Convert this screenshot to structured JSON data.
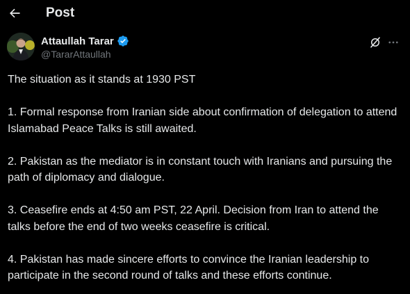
{
  "header": {
    "title": "Post",
    "back_icon": "arrow-left-icon"
  },
  "author": {
    "display_name": "Attaullah Tarar",
    "handle": "@TararAttaullah",
    "verified_color": "#1d9bf0"
  },
  "actions": {
    "grok_icon": "grok-icon",
    "more_icon": "more-horizontal-icon"
  },
  "post": {
    "paragraphs": [
      "The situation as it stands at 1930 PST",
      "1. Formal response from Iranian side about confirmation of delegation to attend Islamabad Peace Talks is still awaited.",
      "2. Pakistan as the mediator is in constant touch with Iranians and pursuing the path of diplomacy and dialogue.",
      "3. Ceasefire ends at 4:50 am PST, 22 April. Decision from Iran to attend the talks before the end of two weeks ceasefire is critical.",
      "4. Pakistan has made sincere efforts to convince the Iranian leadership to participate in the second round of talks and these efforts continue."
    ]
  },
  "colors": {
    "background": "#000000",
    "text": "#e7e9ea",
    "secondary_text": "#71767b"
  }
}
